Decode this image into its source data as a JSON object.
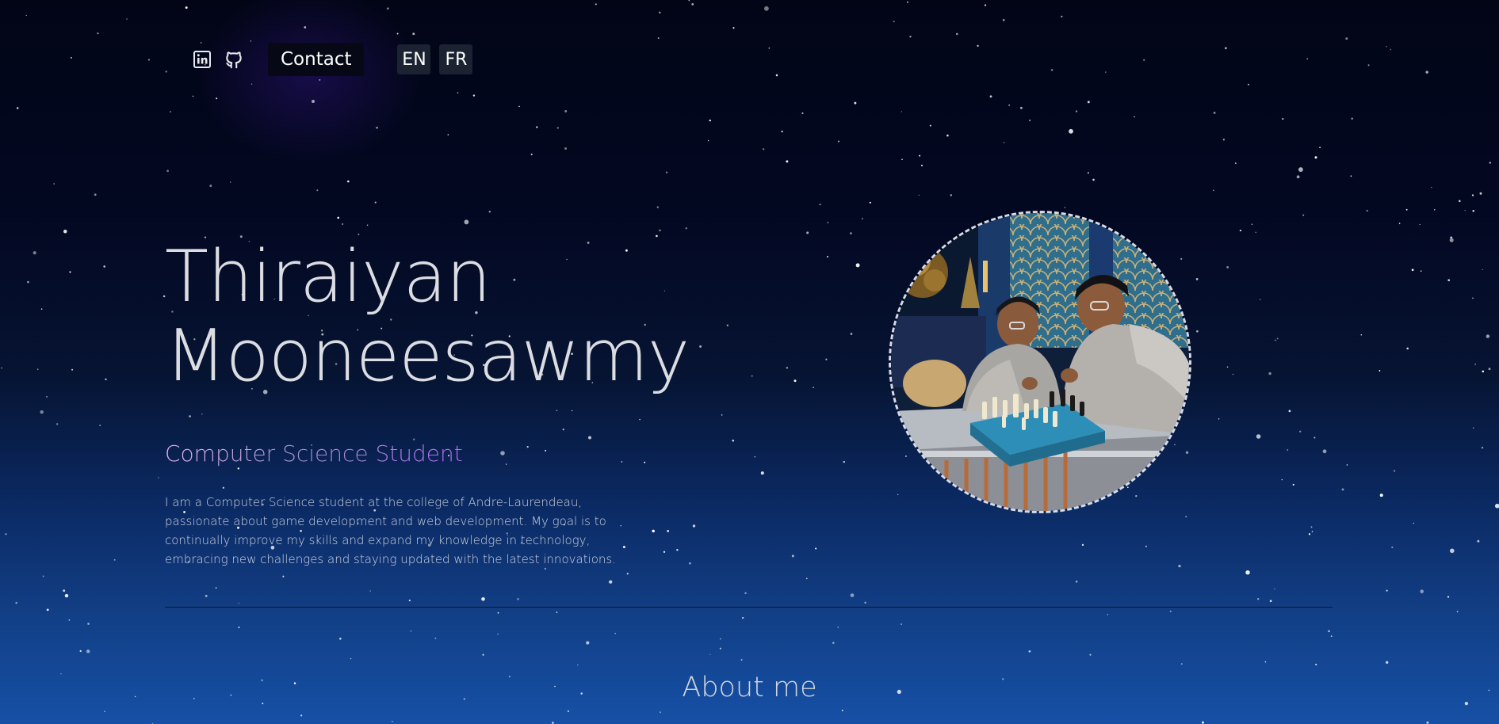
{
  "header": {
    "icons": [
      {
        "name": "linkedin-icon"
      },
      {
        "name": "github-icon"
      }
    ],
    "contact_label": "Contact",
    "languages": [
      "EN",
      "FR"
    ]
  },
  "hero": {
    "first_name": "Thiraiyan",
    "last_name": "Mooneesawmy",
    "subtitle": "Computer Science Student",
    "bio": "I am a Computer Science student at the college of Andre-Laurendeau, passionate about game development and web development. My goal is to continually improve my skills and expand my knowledge in technology, embracing new challenges and staying updated with the latest innovations."
  },
  "about": {
    "title": "About me"
  },
  "colors": {
    "background_top": "#020516",
    "background_bottom": "#1650a6",
    "subtitle_gradient": [
      "#e9b3ec",
      "#9d94c8",
      "#b26bf2"
    ],
    "text": "#dcdde3"
  }
}
